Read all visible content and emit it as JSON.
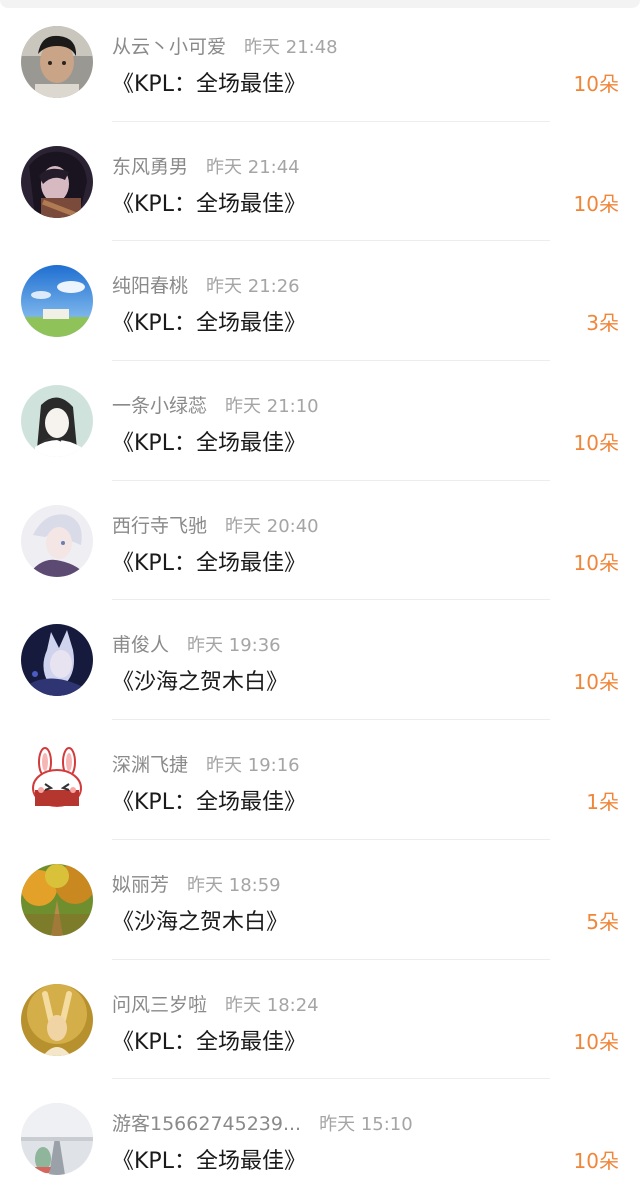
{
  "entries": [
    {
      "name": "从云丶小可爱",
      "time": "昨天 21:48",
      "gift": "《KPL：全场最佳》",
      "count": "10朵",
      "avatar": "avatar-photo-boy"
    },
    {
      "name": "东风勇男",
      "time": "昨天 21:44",
      "gift": "《KPL：全场最佳》",
      "count": "10朵",
      "avatar": "avatar-anime-dark"
    },
    {
      "name": "纯阳春桃",
      "time": "昨天 21:26",
      "gift": "《KPL：全场最佳》",
      "count": "3朵",
      "avatar": "avatar-sky-scene"
    },
    {
      "name": "一条小绿蕊",
      "time": "昨天 21:10",
      "gift": "《KPL：全场最佳》",
      "count": "10朵",
      "avatar": "avatar-sketch-girl"
    },
    {
      "name": "西行寺飞驰",
      "time": "昨天 20:40",
      "gift": "《KPL：全场最佳》",
      "count": "10朵",
      "avatar": "avatar-anime-white"
    },
    {
      "name": "甫俊人",
      "time": "昨天 19:36",
      "gift": "《沙海之贺木白》",
      "count": "10朵",
      "avatar": "avatar-anime-night"
    },
    {
      "name": "深渊飞捷",
      "time": "昨天 19:16",
      "gift": "《KPL：全场最佳》",
      "count": "1朵",
      "avatar": "avatar-bunny"
    },
    {
      "name": "姒丽芳",
      "time": "昨天 18:59",
      "gift": "《沙海之贺木白》",
      "count": "5朵",
      "avatar": "avatar-autumn-road"
    },
    {
      "name": "问风三岁啦",
      "time": "昨天 18:24",
      "gift": "《KPL：全场最佳》",
      "count": "10朵",
      "avatar": "avatar-golden-portrait"
    },
    {
      "name": "游客15662745239...",
      "time": "昨天 15:10",
      "gift": "《KPL：全场最佳》",
      "count": "10朵",
      "avatar": "avatar-road-pale"
    }
  ],
  "colors": {
    "count": "#f0863a",
    "name": "#8a8a8a",
    "time": "#a5a5a5",
    "gift": "#1a1a1a"
  }
}
